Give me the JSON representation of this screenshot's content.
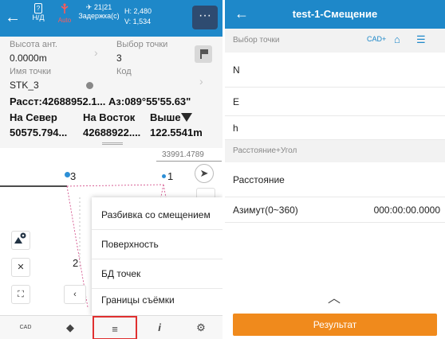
{
  "left": {
    "topbar": {
      "back_glyph": "←",
      "solution": "Н/Д",
      "solution_box": "?",
      "antenna": "Auto",
      "sat_count": "21|21",
      "delay": "Задержка(с)",
      "h": "H: 2,480",
      "v": "V: 1,534",
      "more": "···"
    },
    "info": {
      "ant_height_label": "Высота ант.",
      "ant_height_value": "0.0000m",
      "point_select_label": "Выбор точки",
      "point_select_value": "3",
      "point_name_label": "Имя точки",
      "point_name_value": "STK_3",
      "code_label": "Код",
      "dist_az": "Расст:42688952.1... Аз:089°55'55.63\"",
      "north_label": "На Север",
      "east_label": "На Восток",
      "above_label": "Выше",
      "north_value": "50575.794...",
      "east_value": "42688922....",
      "above_value": "122.5541m"
    },
    "map": {
      "scale": "33991.4789",
      "points": [
        "3",
        "1",
        "2"
      ]
    },
    "menu": {
      "items": [
        "Разбивка со смещением",
        "Поверхность",
        "БД точек",
        "Границы съёмки"
      ]
    },
    "bottom": {
      "cad": "CAD",
      "layers": "◆",
      "menu": "≡",
      "info": "i",
      "settings": "⚙"
    }
  },
  "right": {
    "title": "test-1-Смещение",
    "back_glyph": "←",
    "point_select_label": "Выбор точки",
    "rows": [
      "N",
      "E",
      "h"
    ],
    "section2": "Расстояние+Угол",
    "distance_label": "Расстояние",
    "azimuth_label": "Азимут(0~360)",
    "azimuth_value": "000:00:00.0000",
    "result_button": "Результат"
  },
  "colors": {
    "header_blue": "#1e88c9",
    "accent_orange": "#f08a1c",
    "selected_red": "#e03030"
  }
}
